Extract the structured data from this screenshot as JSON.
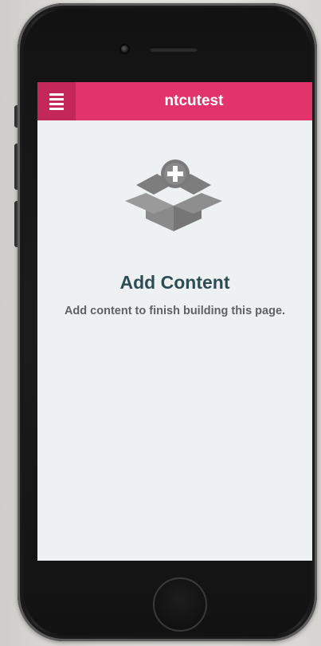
{
  "app": {
    "title": "ntcutest",
    "accent_color": "#e2336a",
    "menu_button_color": "#c4285a",
    "menu_icon": "hamburger-menu-icon"
  },
  "empty_state": {
    "icon": "add-content-box-icon",
    "title": "Add Content",
    "description": "Add content to finish building this page."
  },
  "device": {
    "model_hint": "smartphone-frame"
  }
}
